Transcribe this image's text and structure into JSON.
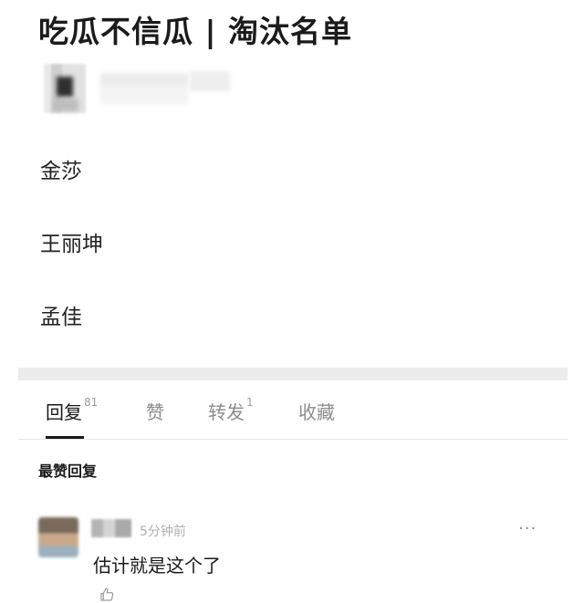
{
  "post": {
    "title": "吃瓜不信瓜 | 淘汰名单",
    "list": [
      "金莎",
      "王丽坤",
      "孟佳"
    ]
  },
  "tabs": [
    {
      "label": "回复",
      "count": "81"
    },
    {
      "label": "赞",
      "count": ""
    },
    {
      "label": "转发",
      "count": "1"
    },
    {
      "label": "收藏",
      "count": ""
    }
  ],
  "comments_section": {
    "label": "最赞回复",
    "comments": [
      {
        "time": "5分钟前",
        "text": "估计就是这个了",
        "more": "···"
      }
    ]
  }
}
